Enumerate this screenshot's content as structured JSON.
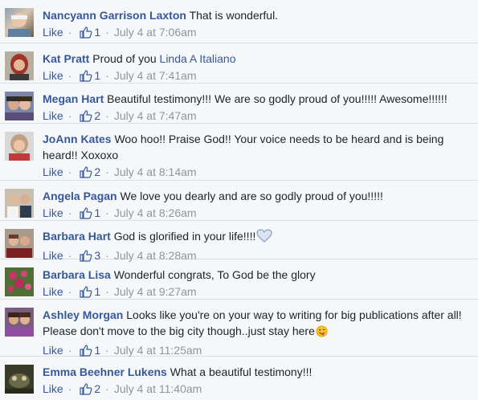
{
  "comments": [
    {
      "author": "Nancyann Garrison Laxton",
      "text": "That is wonderful.",
      "mention": "",
      "like_label": "Like",
      "likes": "1",
      "time": "July 4 at 7:06am"
    },
    {
      "author": "Kat Pratt",
      "text": "Proud of you",
      "mention": "Linda A Italiano",
      "like_label": "Like",
      "likes": "1",
      "time": "July 4 at 7:41am"
    },
    {
      "author": "Megan Hart",
      "text": "Beautiful testimony!!! We are so godly proud of you!!!!! Awesome!!!!!!",
      "mention": "",
      "like_label": "Like",
      "likes": "2",
      "time": "July 4 at 7:47am"
    },
    {
      "author": "JoAnn Kates",
      "text": "Woo hoo!! Praise God!! Your voice needs to be heard and is being heard!! Xoxoxo",
      "mention": "",
      "like_label": "Like",
      "likes": "2",
      "time": "July 4 at 8:14am"
    },
    {
      "author": "Angela Pagan",
      "text": "We love you dearly and are so godly proud of you!!!!!",
      "mention": "",
      "like_label": "Like",
      "likes": "1",
      "time": "July 4 at 8:26am"
    },
    {
      "author": "Barbara Hart",
      "text": "God is glorified in your life!!!!",
      "mention": "",
      "like_label": "Like",
      "likes": "3",
      "time": "July 4 at 8:28am"
    },
    {
      "author": "Barbara Lisa",
      "text": "Wonderful congrats, To God be the glory",
      "mention": "",
      "like_label": "Like",
      "likes": "1",
      "time": "July 4 at 9:27am"
    },
    {
      "author": "Ashley Morgan",
      "text": "Looks like you're on your way to writing for big publications after all! Please don't move to the big city though..just stay here",
      "mention": "",
      "like_label": "Like",
      "likes": "1",
      "time": "July 4 at 11:25am"
    },
    {
      "author": "Emma Beehner Lukens",
      "text": "What a beautiful testimony!!!",
      "mention": "",
      "like_label": "Like",
      "likes": "2",
      "time": "July 4 at 11:40am"
    }
  ],
  "colors": {
    "link": "#365899",
    "meta": "#90949c",
    "background": "#f6f7f9"
  }
}
